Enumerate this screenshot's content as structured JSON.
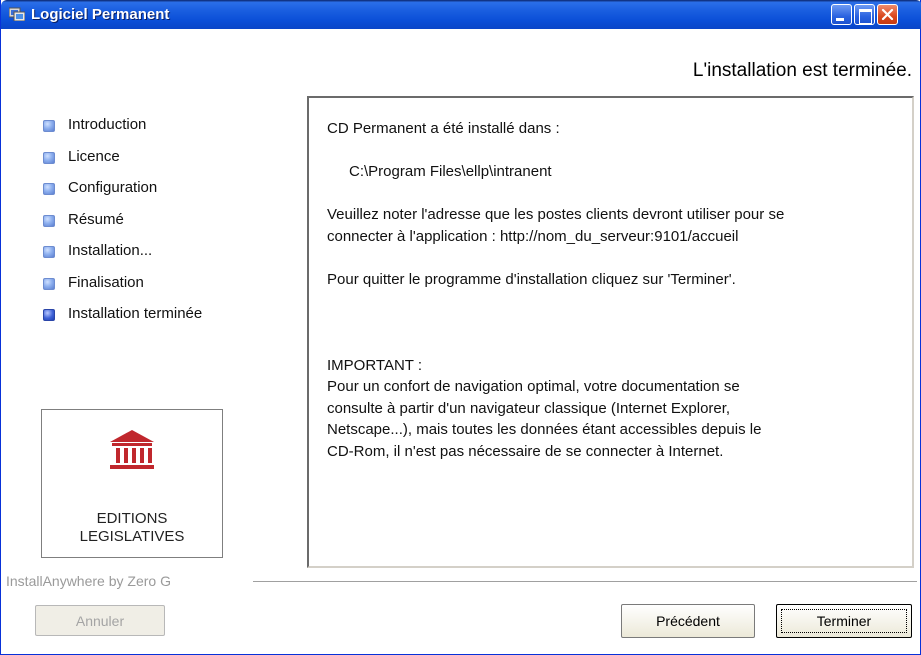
{
  "window": {
    "title": "Logiciel Permanent"
  },
  "heading": "L'installation est terminée.",
  "steps": [
    {
      "label": "Introduction",
      "active": false
    },
    {
      "label": "Licence",
      "active": false
    },
    {
      "label": "Configuration",
      "active": false
    },
    {
      "label": "Résumé",
      "active": false
    },
    {
      "label": "Installation...",
      "active": false
    },
    {
      "label": "Finalisation",
      "active": false
    },
    {
      "label": "Installation terminée",
      "active": true
    }
  ],
  "logo": {
    "line1": "EDITIONS",
    "line2": "LEGISLATIVES",
    "color": "#c0272d"
  },
  "content": {
    "installed_in": "CD Permanent a été installé dans :",
    "path": "C:\\Program Files\\ellp\\intranent",
    "note_line1": "Veuillez noter l'adresse que les postes clients devront utiliser pour se",
    "note_line2": "connecter à l'application : http://nom_du_serveur:9101/accueil",
    "quit": "Pour quitter le programme d'installation cliquez sur 'Terminer'.",
    "important_title": "IMPORTANT :",
    "important_line1": "Pour un confort de navigation optimal, votre documentation se",
    "important_line2": "consulte à partir d'un navigateur classique (Internet Explorer,",
    "important_line3": "Netscape...), mais toutes les données étant accessibles depuis le",
    "important_line4": "CD-Rom, il n'est pas nécessaire de se connecter à Internet."
  },
  "footer": {
    "brand": "InstallAnywhere by Zero G",
    "cancel_label": "Annuler",
    "prev_label": "Précédent",
    "finish_label": "Terminer"
  },
  "colors": {
    "titlebar": "#0b4fd8",
    "close_button": "#d9471e"
  }
}
